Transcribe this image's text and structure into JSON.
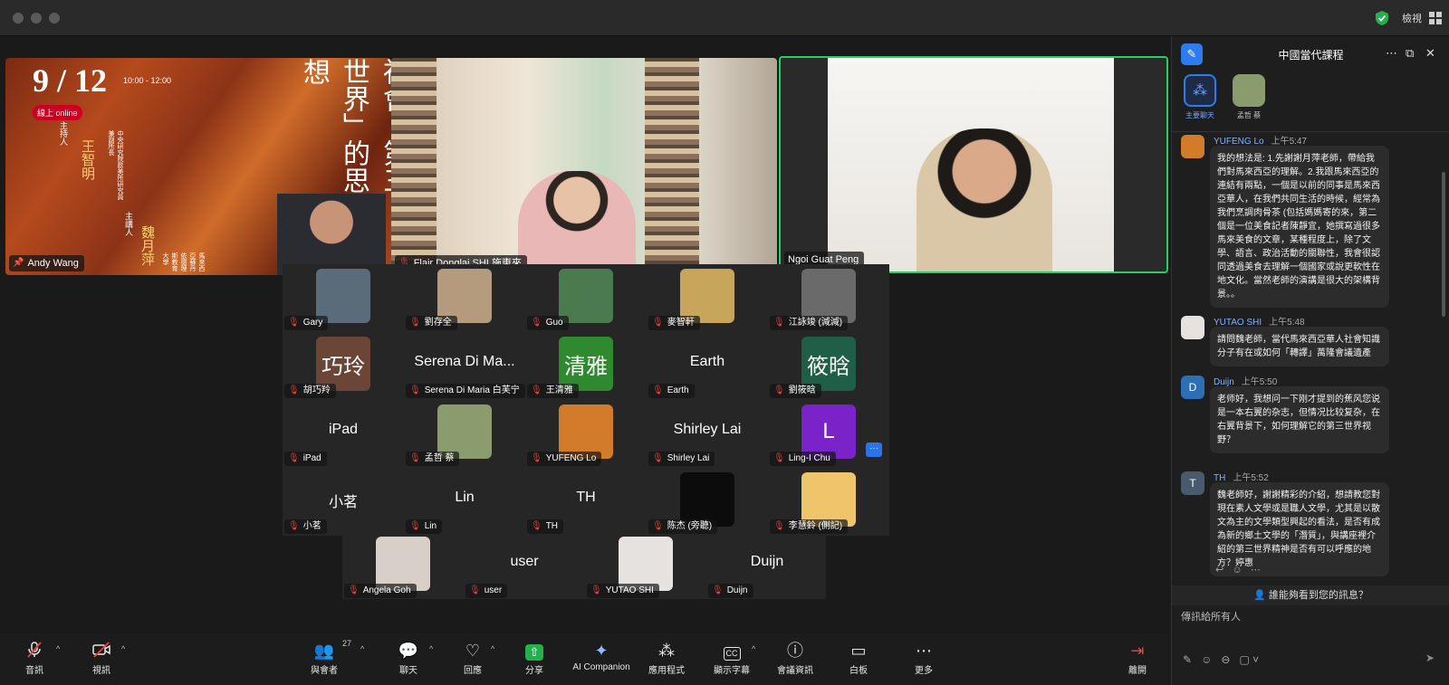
{
  "window": {
    "view_label": "檢視"
  },
  "poster": {
    "date": "9 / 12",
    "time": "10:00 - 12:00",
    "online": "線上 online",
    "title_vertical": "社會：第三世界」的思想",
    "host_role": "主持人",
    "host_name": "王智明",
    "host_affil": "中央研究院歐美所研究員兼副所長",
    "speaker_role": "主講人",
    "speaker_name": "魏月萍",
    "speaker_affil": "馬來西亞蘇丹依德理斯教育大學"
  },
  "top_tiles": [
    {
      "name": "Andy Wang"
    },
    {
      "name": "Flair Donglai SHI 施東來"
    },
    {
      "name": "Ngoi Guat Peng"
    }
  ],
  "gallery": [
    {
      "name": "Gary",
      "type": "photo",
      "color": "#5a6b7a"
    },
    {
      "name": "劉存全",
      "type": "photo",
      "color": "#b49b7e"
    },
    {
      "name": "Guo",
      "type": "photo",
      "color": "#4b7a4e"
    },
    {
      "name": "麥智軒",
      "type": "photo",
      "color": "#c7a55b"
    },
    {
      "name": "江詠竣 (減減)",
      "type": "photo",
      "color": "#6a6a6a"
    },
    {
      "name": "胡巧羚",
      "type": "text",
      "avatar_text": "巧玲",
      "color": "#6b4636"
    },
    {
      "name": "Serena Di Maria 白芙宁",
      "type": "big",
      "big": "Serena Di Ma..."
    },
    {
      "name": "王清雅",
      "type": "text",
      "avatar_text": "清雅",
      "color": "#2f8a2f"
    },
    {
      "name": "Earth",
      "type": "big",
      "big": "Earth"
    },
    {
      "name": "劉筱晗",
      "type": "text",
      "avatar_text": "筱晗",
      "color": "#1f5e47"
    },
    {
      "name": "iPad",
      "type": "big",
      "big": "iPad"
    },
    {
      "name": "孟哲 蔡",
      "type": "photo",
      "color": "#8a9b6e"
    },
    {
      "name": "YUFENG Lo",
      "type": "photo",
      "color": "#d27c2b"
    },
    {
      "name": "Shirley Lai",
      "type": "big",
      "big": "Shirley Lai"
    },
    {
      "name": "Ling-I Chu",
      "type": "text",
      "avatar_text": "L",
      "color": "#7a23c9"
    },
    {
      "name": "小茗",
      "type": "big",
      "big": "小茗"
    },
    {
      "name": "Lin",
      "type": "big",
      "big": "Lin"
    },
    {
      "name": "TH",
      "type": "big",
      "big": "TH"
    },
    {
      "name": "陈杰 (旁聽)",
      "type": "photo",
      "color": "#0c0c0c"
    },
    {
      "name": "李慧鈴 (側記)",
      "type": "photo",
      "color": "#f0c46a"
    }
  ],
  "gallery_last": [
    {
      "name": "Angela Goh",
      "type": "photo",
      "color": "#d8cfc8"
    },
    {
      "name": "user",
      "type": "big",
      "big": "user"
    },
    {
      "name": "YUTAO SHI",
      "type": "photo",
      "color": "#e6e2df"
    },
    {
      "name": "Duijn",
      "type": "big",
      "big": "Duijn"
    }
  ],
  "toolbar": {
    "audio": "音訊",
    "video": "視訊",
    "participants": "與會者",
    "participants_count": "27",
    "chat": "聊天",
    "react": "回應",
    "share": "分享",
    "ai": "AI Companion",
    "apps": "應用程式",
    "captions": "顯示字幕",
    "info": "會議資訊",
    "whiteboard": "白板",
    "more": "更多",
    "leave": "離開"
  },
  "chat": {
    "title": "中國當代課程",
    "tabs": [
      "主要聊天",
      "孟哲 蔡"
    ],
    "messages": [
      {
        "sender": "YUFENG Lo",
        "time": "上午5:47",
        "avatar_color": "#d27c2b",
        "avatar_text": "",
        "text": "我的想法是: 1.先謝謝月萍老師，帶給我們對馬來西亞的理解。2.我跟馬來西亞的連結有兩點，一個是以前的同事是馬來西亞華人，在我們共同生活的時候，經常為我們烹調肉骨茶 (包括媽媽寄的來，第二個是一位美食記者陳靜宜，她撰寫過很多馬來美食的文章，某種程度上，除了文學、語言、政治活動的關聯性，我會很認同透過美食去理解一個國家或說更軟性在地文化。當然老師的演講是很大的架構背景。。"
      },
      {
        "sender": "YUTAO SHI",
        "time": "上午5:48",
        "avatar_color": "#e6e2df",
        "avatar_text": "",
        "text": "請問魏老師，當代馬來西亞華人社會知識分子有在或如何「轉譯」萬隆會議遺產"
      },
      {
        "sender": "Duijn",
        "time": "上午5:50",
        "avatar_color": "#2d6fb5",
        "avatar_text": "D",
        "text": "老师好，我想问一下刚才提到的蕉风您说是一本右翼的杂志，但情况比较复杂，在右翼背景下，如何理解它的第三世界视野？"
      },
      {
        "sender": "TH",
        "time": "上午5:52",
        "avatar_color": "#4a5a6e",
        "avatar_text": "T",
        "text": "魏老師好，謝謝精彩的介紹，想請教您對現在素人文學或是職人文學，尤其是以散文為主的文學類型興起的看法，是否有成為新的鄉土文學的「潛質」，與講座裡介紹的第三世界精神是否有可以呼應的地方？婷惠"
      }
    ],
    "who_can_see": "誰能夠看到您的訊息？",
    "input_placeholder": "傳訊給所有人"
  }
}
